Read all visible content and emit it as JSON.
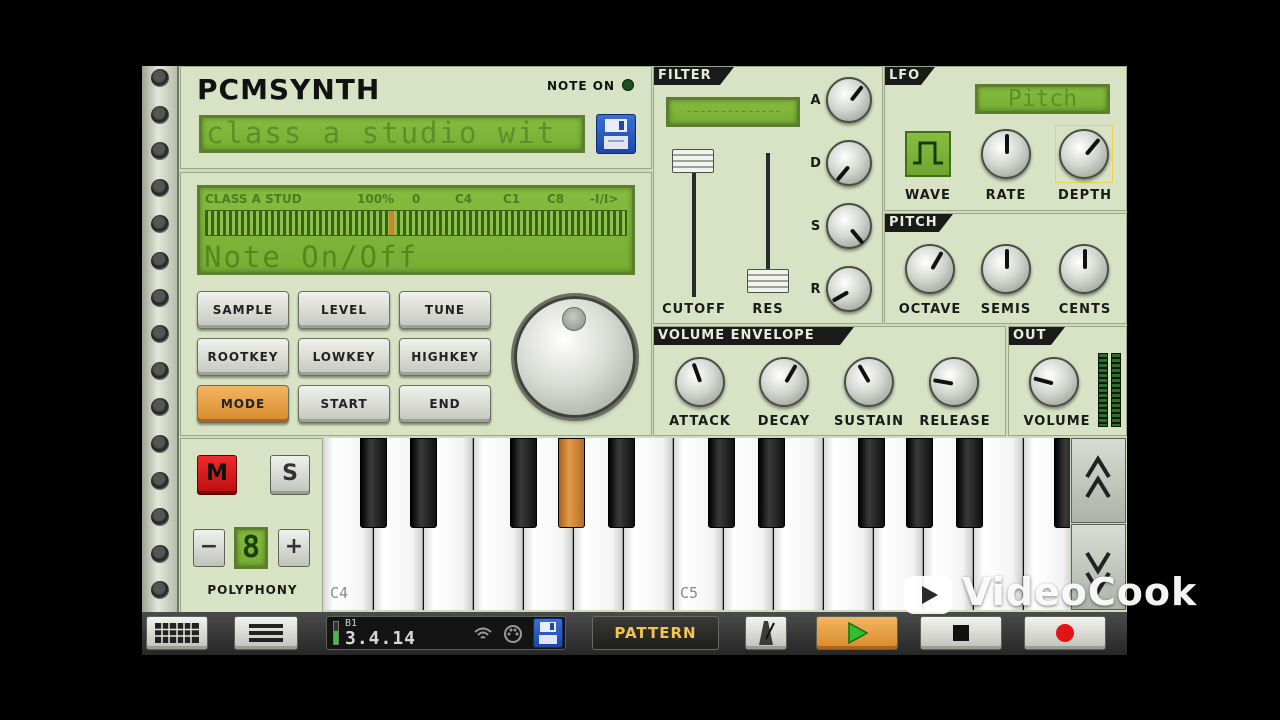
{
  "app": {
    "logo": "PCMSYNTH",
    "note_on_label": "NOTE ON"
  },
  "preset": {
    "name": "class a studio wit"
  },
  "display": {
    "status": [
      "CLASS A STUD",
      "100%",
      "0",
      "C4",
      "C1",
      "C8",
      "-I/I>"
    ],
    "message": "Note On/Off"
  },
  "sample_buttons": [
    {
      "label": "SAMPLE"
    },
    {
      "label": "LEVEL"
    },
    {
      "label": "TUNE"
    },
    {
      "label": "ROOTKEY"
    },
    {
      "label": "LOWKEY"
    },
    {
      "label": "HIGHKEY"
    },
    {
      "label": "MODE"
    },
    {
      "label": "START"
    },
    {
      "label": "END"
    }
  ],
  "filter": {
    "title": "FILTER",
    "display_value": "--------------",
    "cutoff_label": "CUTOFF",
    "res_label": "RES",
    "cutoff_value": 0.85,
    "res_value": 0.05,
    "adsr_labels": [
      "A",
      "D",
      "S",
      "R"
    ]
  },
  "lfo": {
    "title": "LFO",
    "target": "Pitch",
    "wave_label": "WAVE",
    "rate_label": "RATE",
    "depth_label": "DEPTH"
  },
  "pitch": {
    "title": "PITCH",
    "octave_label": "OCTAVE",
    "semis_label": "SEMIS",
    "cents_label": "CENTS"
  },
  "volume_envelope": {
    "title": "VOLUME ENVELOPE",
    "attack_label": "ATTACK",
    "decay_label": "DECAY",
    "sustain_label": "SUSTAIN",
    "release_label": "RELEASE"
  },
  "out": {
    "title": "OUT",
    "volume_label": "VOLUME"
  },
  "channel": {
    "mute": "M",
    "solo": "S"
  },
  "polyphony": {
    "label": "POLYPHONY",
    "value": "8",
    "minus": "−",
    "plus": "+"
  },
  "keyboard": {
    "c4_label": "C4",
    "c5_label": "C5"
  },
  "toolbar": {
    "bank": "B1",
    "position": "3.4.14",
    "pattern_label": "PATTERN"
  },
  "watermark": "VideoCook",
  "colors": {
    "lcd_green": "#7db63a",
    "accent_orange": "#e39a48",
    "record_red": "#e21414",
    "play_green": "#2fbf2f"
  }
}
